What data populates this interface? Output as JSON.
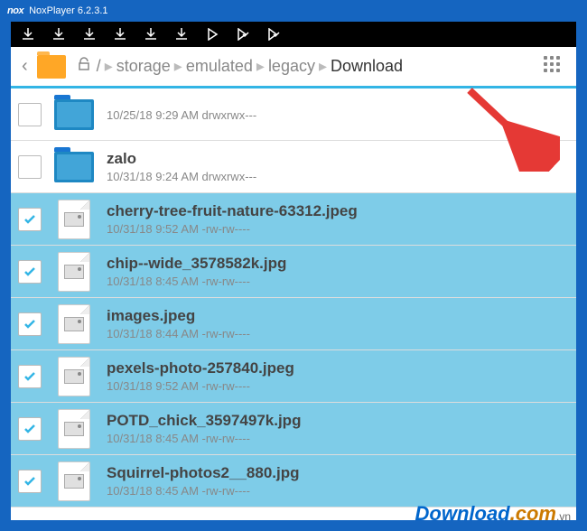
{
  "titlebar": {
    "logo": "nox",
    "title": "NoxPlayer 6.2.3.1"
  },
  "breadcrumbs": {
    "root": "/",
    "segments": [
      "storage",
      "emulated",
      "legacy",
      "Download"
    ]
  },
  "items": [
    {
      "name": "",
      "date": "10/25/18 9:29 AM",
      "perm": "drwxrwx---",
      "type": "folder",
      "selected": false
    },
    {
      "name": "zalo",
      "date": "10/31/18 9:24 AM",
      "perm": "drwxrwx---",
      "type": "folder",
      "selected": false
    },
    {
      "name": "cherry-tree-fruit-nature-63312.jpeg",
      "date": "10/31/18 9:52 AM",
      "perm": "-rw-rw----",
      "type": "image",
      "selected": true
    },
    {
      "name": "chip--wide_3578582k.jpg",
      "date": "10/31/18 8:45 AM",
      "perm": "-rw-rw----",
      "type": "image",
      "selected": true
    },
    {
      "name": "images.jpeg",
      "date": "10/31/18 8:44 AM",
      "perm": "-rw-rw----",
      "type": "image",
      "selected": true
    },
    {
      "name": "pexels-photo-257840.jpeg",
      "date": "10/31/18 9:52 AM",
      "perm": "-rw-rw----",
      "type": "image",
      "selected": true
    },
    {
      "name": "POTD_chick_3597497k.jpg",
      "date": "10/31/18 8:45 AM",
      "perm": "-rw-rw----",
      "type": "image",
      "selected": true
    },
    {
      "name": "Squirrel-photos2__880.jpg",
      "date": "10/31/18 8:45 AM",
      "perm": "-rw-rw----",
      "type": "image",
      "selected": true
    }
  ],
  "watermark": {
    "part1": "Download",
    "part2": ".com",
    "part3": ".vn"
  }
}
